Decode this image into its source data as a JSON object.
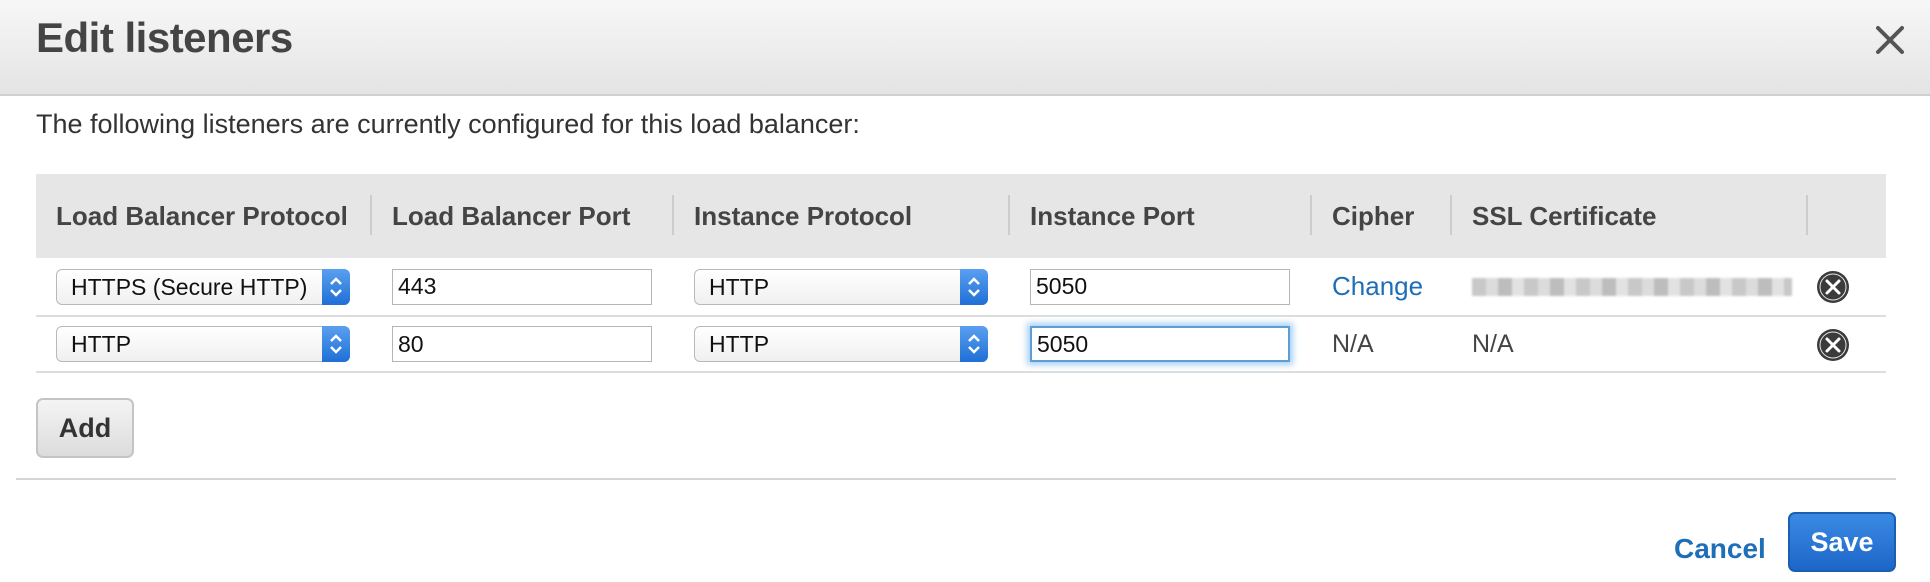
{
  "dialog": {
    "title": "Edit listeners",
    "close_icon": "close-icon",
    "intro": "The following listeners are currently configured for this load balancer:"
  },
  "table": {
    "headers": {
      "lb_protocol": "Load Balancer Protocol",
      "lb_port": "Load Balancer Port",
      "instance_protocol": "Instance Protocol",
      "instance_port": "Instance Port",
      "cipher": "Cipher",
      "ssl_certificate": "SSL Certificate"
    },
    "rows": [
      {
        "lb_protocol": "HTTPS (Secure HTTP)",
        "lb_port": "443",
        "instance_protocol": "HTTP",
        "instance_port": "5050",
        "cipher": "Change",
        "ssl_certificate": ""
      },
      {
        "lb_protocol": "HTTP",
        "lb_port": "80",
        "instance_protocol": "HTTP",
        "instance_port": "5050",
        "cipher": "N/A",
        "ssl_certificate": "N/A"
      }
    ]
  },
  "actions": {
    "add_label": "Add",
    "cancel_label": "Cancel",
    "save_label": "Save"
  },
  "colors": {
    "accent": "#1f6fb8",
    "primary_button": "#2a78d8",
    "focus_ring": "#5b9dd9"
  }
}
